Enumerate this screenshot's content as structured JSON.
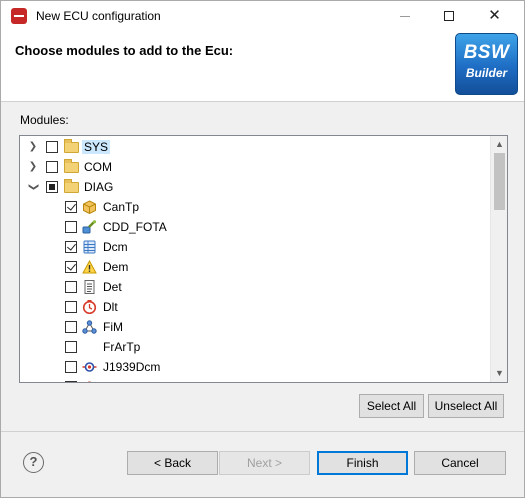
{
  "window": {
    "title": "New ECU configuration"
  },
  "header": {
    "title": "Choose modules to add to the Ecu:",
    "logo_line1": "BSW",
    "logo_line2": "Builder"
  },
  "modules_label": "Modules:",
  "tree": {
    "items": [
      {
        "label": "SYS",
        "expander": "right",
        "checkbox": "unchecked",
        "icon": "folder-icon",
        "selected": true
      },
      {
        "label": "COM",
        "expander": "right",
        "checkbox": "unchecked",
        "icon": "folder-icon"
      },
      {
        "label": "DIAG",
        "expander": "down",
        "checkbox": "partial",
        "icon": "folder-icon"
      },
      {
        "label": "CanTp",
        "checkbox": "checked",
        "icon": "package-icon"
      },
      {
        "label": "CDD_FOTA",
        "checkbox": "unchecked",
        "icon": "wrench-plugin-icon"
      },
      {
        "label": "Dcm",
        "checkbox": "checked",
        "icon": "database-icon"
      },
      {
        "label": "Dem",
        "checkbox": "checked",
        "icon": "warning-icon"
      },
      {
        "label": "Det",
        "checkbox": "unchecked",
        "icon": "document-icon"
      },
      {
        "label": "Dlt",
        "checkbox": "unchecked",
        "icon": "clock-icon"
      },
      {
        "label": "FiM",
        "checkbox": "unchecked",
        "icon": "network-icon"
      },
      {
        "label": "FrArTp",
        "checkbox": "unchecked",
        "icon": "none"
      },
      {
        "label": "J1939Dcm",
        "checkbox": "unchecked",
        "icon": "j1939-icon"
      }
    ]
  },
  "buttons": {
    "select_all": "Select All",
    "unselect_all": "Unselect All",
    "back": "< Back",
    "next": "Next >",
    "finish": "Finish",
    "cancel": "Cancel",
    "help": "?"
  },
  "colors": {
    "selection": "#cce8ff",
    "default_button_border": "#0078d7",
    "logo": "#1e6dc4"
  }
}
